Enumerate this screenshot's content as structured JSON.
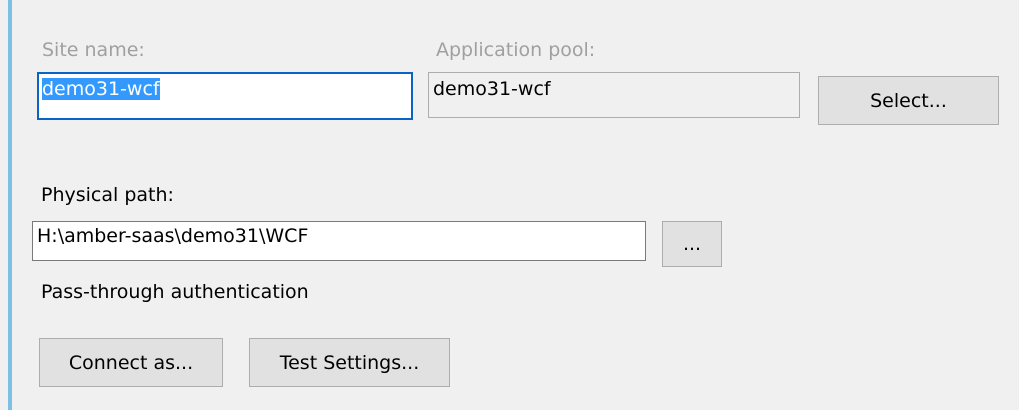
{
  "site_name": {
    "label": "Site name:",
    "value": "demo31-wcf"
  },
  "application_pool": {
    "label": "Application pool:",
    "value": "demo31-wcf",
    "select_button": "Select..."
  },
  "physical_path": {
    "label": "Physical path:",
    "value": "H:\\amber-saas\\demo31\\WCF",
    "browse_button": "..."
  },
  "pass_through": {
    "label": "Pass-through authentication"
  },
  "buttons": {
    "connect_as": "Connect as...",
    "test_settings": "Test Settings..."
  },
  "colors": {
    "accent": "#7dc0e6",
    "selection": "#3399ff",
    "focus_border": "#0a64c7"
  }
}
